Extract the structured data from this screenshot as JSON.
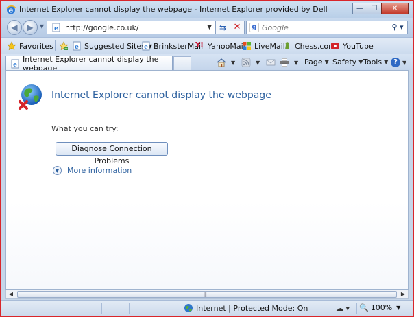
{
  "window": {
    "title": "Internet Explorer cannot display the webpage - Internet Explorer provided by Dell",
    "minimize_glyph": "—",
    "maximize_glyph": "☐",
    "close_glyph": "✕"
  },
  "address": {
    "url": "http://google.co.uk/",
    "search_placeholder": "Google"
  },
  "favorites_bar": {
    "favorites_label": "Favorites",
    "items": [
      {
        "label": "Suggested Sites",
        "icon": "ie-page-icon",
        "dropdown": true
      },
      {
        "label": "BrinksterMail",
        "icon": "ie-page-icon"
      },
      {
        "label": "YahooMail",
        "icon": "yahoo-icon"
      },
      {
        "label": "LiveMail",
        "icon": "windows-flag-icon"
      },
      {
        "label": "Chess.com",
        "icon": "chess-pawn-icon"
      },
      {
        "label": "YouTube",
        "icon": "youtube-icon"
      }
    ]
  },
  "tabs": [
    {
      "label": "Internet Explorer cannot display the webpage",
      "active": true
    }
  ],
  "command_bar": {
    "page_label": "Page",
    "safety_label": "Safety",
    "tools_label": "Tools"
  },
  "content": {
    "title": "Internet Explorer cannot display the webpage",
    "try_text": "What you can try:",
    "diagnose_button": "Diagnose Connection Problems",
    "more_info": "More information"
  },
  "statusbar": {
    "zone": "Internet | Protected Mode: On",
    "zoom": "100%"
  },
  "colors": {
    "window_border": "#d9262b",
    "title_text": "#2b5f9e",
    "chrome": "#c6d6e9"
  }
}
